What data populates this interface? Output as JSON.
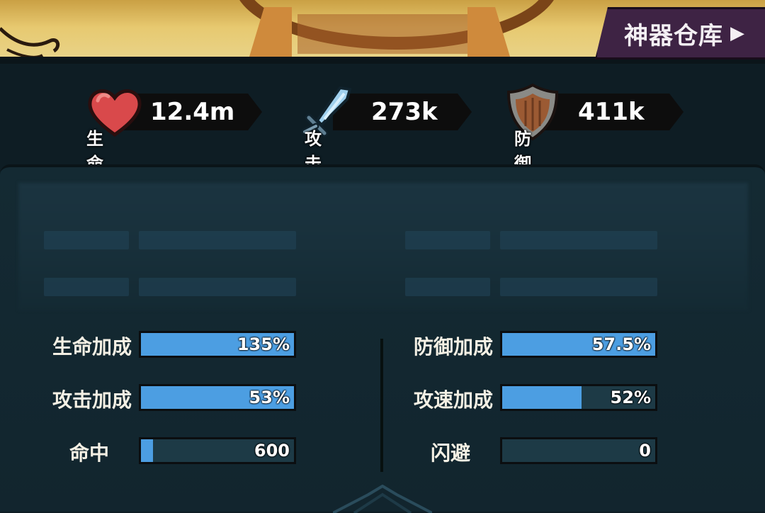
{
  "header": {
    "arsenal_button": "神器仓库",
    "arsenal_arrow": "▶"
  },
  "stats": {
    "hp": {
      "value": "12.4m",
      "label": "生命值"
    },
    "attack": {
      "value": "273k",
      "label": "攻击"
    },
    "defense": {
      "value": "411k",
      "label": "防御"
    }
  },
  "bonuses": {
    "left": [
      {
        "label": "生命加成",
        "value": "135%",
        "fill": 1.0
      },
      {
        "label": "攻击加成",
        "value": "53%",
        "fill": 1.0
      },
      {
        "label": "命中",
        "value": "600",
        "fill": 0.08
      }
    ],
    "right": [
      {
        "label": "防御加成",
        "value": "57.5%",
        "fill": 1.0
      },
      {
        "label": "攻速加成",
        "value": "52%",
        "fill": 0.52
      },
      {
        "label": "闪避",
        "value": "0",
        "fill": 0.0
      }
    ]
  },
  "colors": {
    "bar_fill": "#4c9ee2",
    "bar_track": "#1d3a46",
    "button_bg": "#3e2344"
  },
  "icons": [
    "heart-icon",
    "sword-icon",
    "shield-icon",
    "arrow-right-icon"
  ]
}
